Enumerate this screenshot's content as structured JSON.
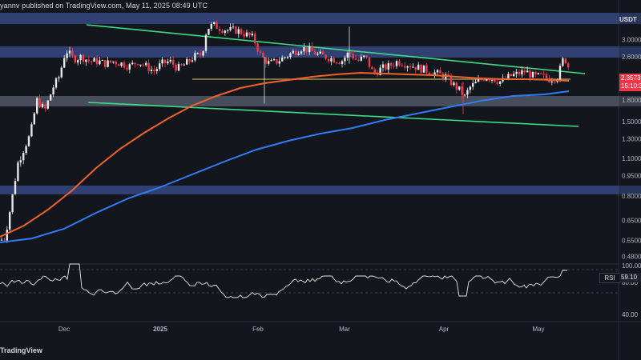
{
  "header": {
    "published_text": "yannv published on TradingView.com, May 11, 2025 08:49 UTC"
  },
  "footer": {
    "brand": "TradingView"
  },
  "price_axis": {
    "currency": "USDT",
    "ticks": [
      "3.0000",
      "2.6000",
      "1.8000",
      "1.5000",
      "1.3000",
      "1.1000",
      "0.9500",
      "0.8000",
      "0.6500",
      "0.5500",
      "0.4800"
    ],
    "last_price": "2.3573",
    "countdown": "15:10:3"
  },
  "rsi": {
    "label": "RSI",
    "value": "59.10",
    "ticks": [
      "100.00",
      "80.00",
      "40.00"
    ]
  },
  "time_axis": [
    "Dec",
    "2025",
    "Feb",
    "Mar",
    "Apr",
    "May"
  ],
  "colors": {
    "background": "#14161d",
    "zone": "#3a4f8f",
    "grey_zone": "#5a6070",
    "trendline": "#3ddc84",
    "ma_fast": "#f0622d",
    "ma_slow": "#2f7cf6",
    "bull": "#e8e8e8",
    "bear": "#ef3b4e",
    "rsi_line": "#e6e6e6",
    "last_price": "#f23645"
  },
  "chart_data": {
    "type": "candlestick",
    "price_scale": "log",
    "ylim": [
      0.45,
      4.2
    ],
    "overlays": [
      "green descending trendline (upper)",
      "green descending trendline (lower)",
      "orange moving average",
      "blue moving average",
      "horizontal support/resistance zones"
    ],
    "rsi_range": [
      0,
      100
    ]
  }
}
